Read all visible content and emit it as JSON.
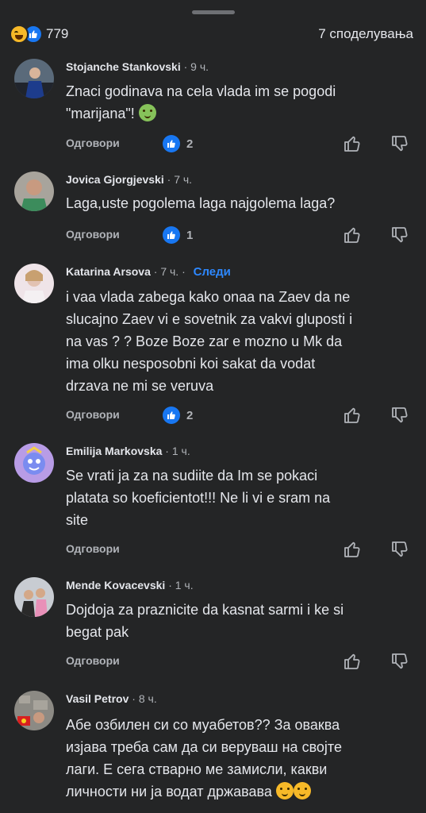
{
  "header": {
    "reaction_count": "779",
    "shares": "7 споделувања",
    "reaction_icons": [
      "laugh-emoji",
      "like-icon"
    ]
  },
  "comments": [
    {
      "author": "Stojanche Stankovski",
      "time": "9 ч.",
      "lines": [
        "Znaci godinava na cela vlada im se pogodi",
        "\"marijana\"! "
      ],
      "emoji": "sick-face",
      "reply_label": "Одговори",
      "likes": "2"
    },
    {
      "author": "Jovica Gjorgjevski",
      "time": "7 ч.",
      "lines": [
        "Laga,uste pogolema laga najgolema laga?"
      ],
      "reply_label": "Одговори",
      "likes": "1"
    },
    {
      "author": "Katarina Arsova",
      "time": "7 ч.",
      "follow_label": "Следи",
      "lines": [
        "i vaa vlada zabega kako onaa na Zaev  da ne",
        "slucajno Zaev vi e sovetnik za vakvi gluposti i",
        "na vas ? ? Boze Boze zar e mozno u Mk da",
        "ima olku nesposobni koi sakat da vodat",
        "drzava ne mi se veruva"
      ],
      "reply_label": "Одговори",
      "likes": "2"
    },
    {
      "author": "Emilija Markovska",
      "time": "1 ч.",
      "lines": [
        "Se vrati ja za na sudiite da Im se pokaci",
        "platata so koeficientot!!! Ne li vi e sram na",
        "site"
      ],
      "reply_label": "Одговори"
    },
    {
      "author": "Mende Kovacevski",
      "time": "1 ч.",
      "lines": [
        "Dojdoja za praznicite da kasnat sarmi i ke si",
        "begat  pak"
      ],
      "reply_label": "Одговори"
    },
    {
      "author": "Vasil Petrov",
      "time": "8 ч.",
      "lines": [
        "Абе озбилен си со муабетов?? За оваква",
        "изјава треба сам да си веруваш на својте",
        "лаги. Е сега стварно ме замисли, какви",
        "личности ни ја водат државава "
      ],
      "emoji": "thinking-face"
    }
  ],
  "colors": {
    "background": "#242526",
    "text": "#e4e6eb",
    "muted": "#b0b3b8",
    "accent": "#2d88ff",
    "like_blue": "#1877f2"
  }
}
